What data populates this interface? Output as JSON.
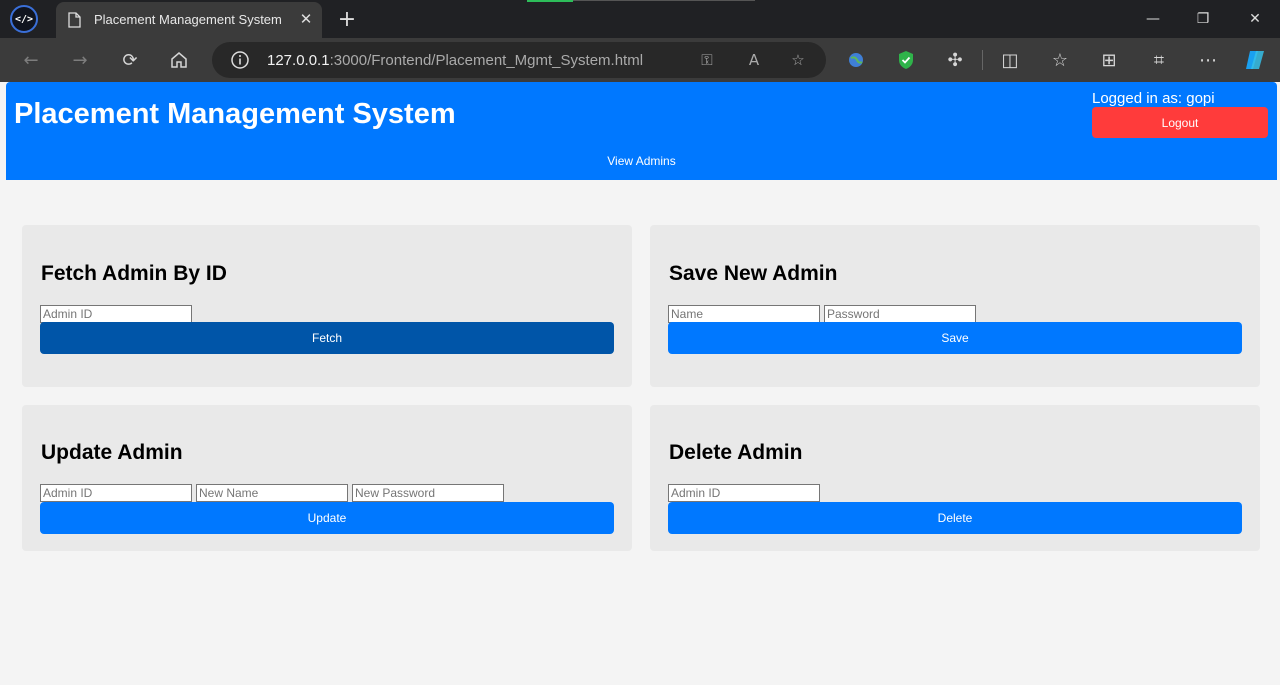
{
  "browser": {
    "tab_title": "Placement Management System",
    "url_host": "127.0.0.1",
    "url_rest": ":3000/Frontend/Placement_Mgmt_System.html"
  },
  "header": {
    "title": "Placement Management System",
    "logged_in": "Logged in as: gopi",
    "logout_label": "Logout",
    "nav_view_admins": "View Admins"
  },
  "fetch_card": {
    "title": "Fetch Admin By ID",
    "admin_id_placeholder": "Admin ID",
    "button_label": "Fetch"
  },
  "save_card": {
    "title": "Save New Admin",
    "name_placeholder": "Name",
    "password_placeholder": "Password",
    "button_label": "Save"
  },
  "update_card": {
    "title": "Update Admin",
    "admin_id_placeholder": "Admin ID",
    "new_name_placeholder": "New Name",
    "new_password_placeholder": "New Password",
    "button_label": "Update"
  },
  "delete_card": {
    "title": "Delete Admin",
    "admin_id_placeholder": "Admin ID",
    "button_label": "Delete"
  },
  "colors": {
    "header_blue": "#0078ff",
    "logout_red": "#ff3b3b",
    "fetch_button_dark_blue": "#0055a8",
    "card_gray": "#e9e9e9"
  }
}
